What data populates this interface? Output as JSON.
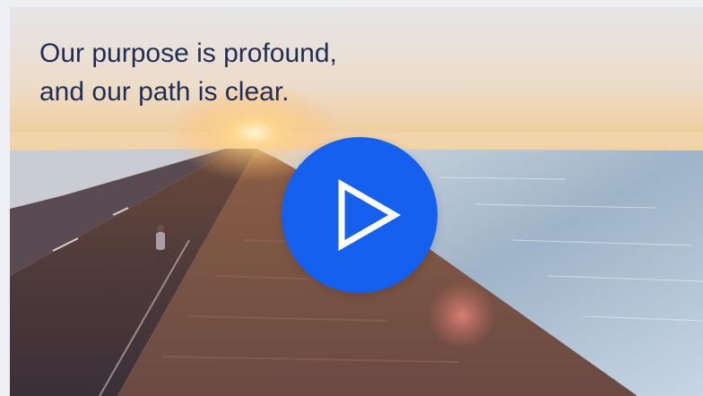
{
  "video": {
    "headline_line1": "Our purpose is profound,",
    "headline_line2": "and our path is clear.",
    "play_icon": "play-icon"
  },
  "colors": {
    "page_background": "#eef0f6",
    "headline_text": "#1f2d57",
    "play_button": "#1660f0",
    "play_icon": "#ffffff"
  }
}
